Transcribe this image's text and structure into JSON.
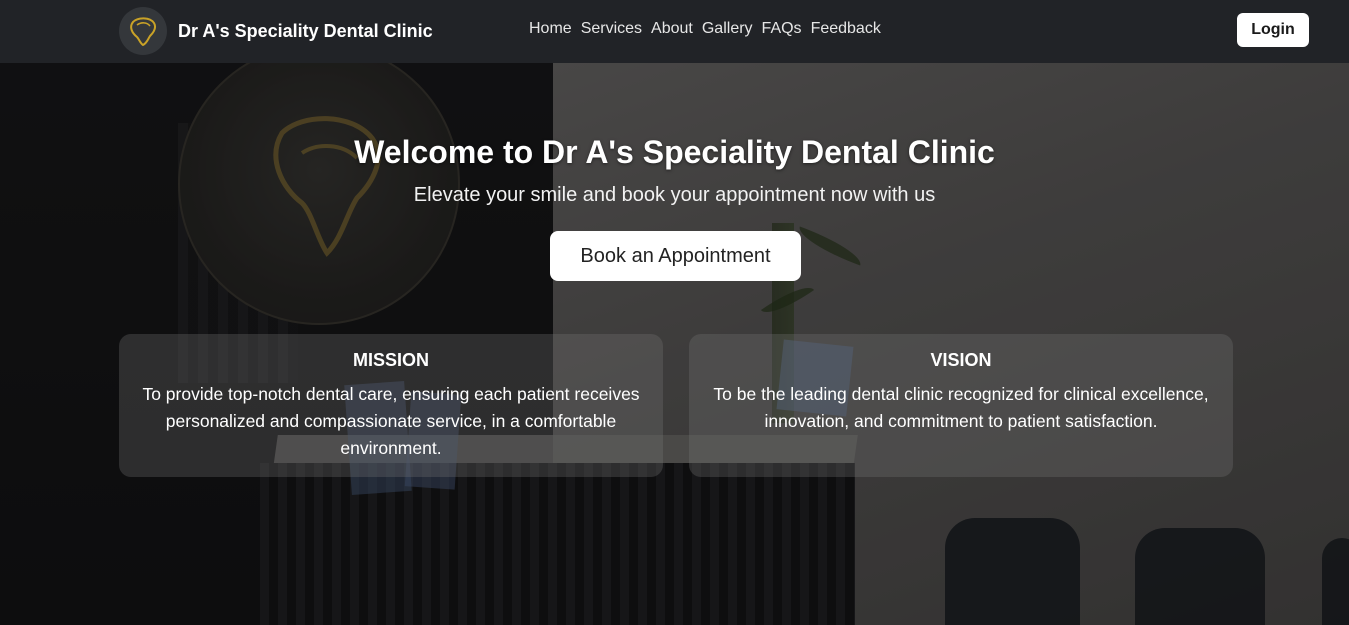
{
  "brand": {
    "name": "Dr A's Speciality Dental Clinic",
    "logo_icon": "tooth-logo-icon",
    "accent_color": "#c9a227"
  },
  "nav": {
    "links": [
      "Home",
      "Services",
      "About",
      "Gallery",
      "FAQs",
      "Feedback"
    ],
    "login_label": "Login"
  },
  "hero": {
    "title": "Welcome to Dr A's Speciality Dental Clinic",
    "subtitle": "Elevate your smile and book your appointment now with us",
    "cta_label": "Book an Appointment"
  },
  "cards": {
    "mission": {
      "title": "MISSION",
      "text": "To provide top-notch dental care, ensuring each patient receives personalized and compassionate service, in a comfortable environment."
    },
    "vision": {
      "title": "VISION",
      "text": "To be the leading dental clinic recognized for clinical excellence, innovation, and commitment to patient satisfaction."
    }
  }
}
